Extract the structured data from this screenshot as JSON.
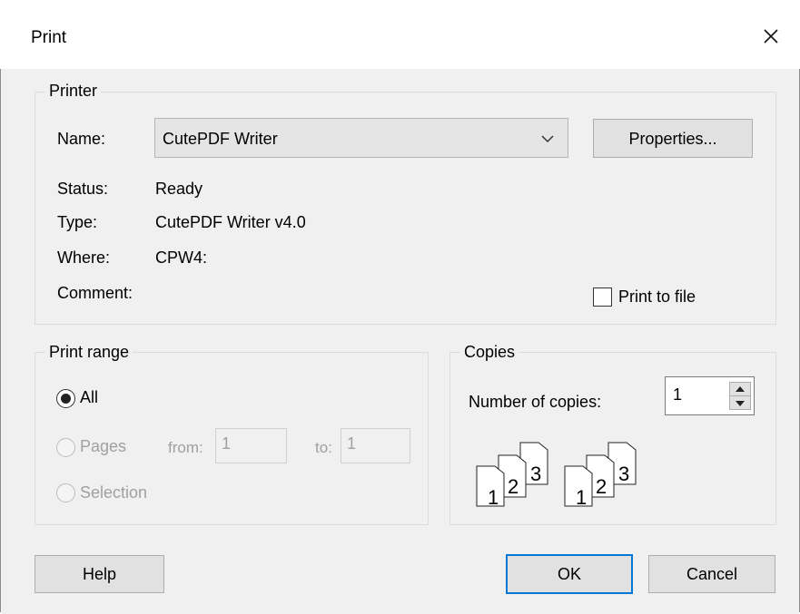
{
  "dialog": {
    "title": "Print"
  },
  "printer": {
    "group_label": "Printer",
    "name_label": "Name:",
    "name_value": "CutePDF Writer",
    "properties_label": "Properties...",
    "status_label": "Status:",
    "status_value": "Ready",
    "type_label": "Type:",
    "type_value": "CutePDF Writer v4.0",
    "where_label": "Where:",
    "where_value": "CPW4:",
    "comment_label": "Comment:",
    "print_to_file_label": "Print to file",
    "print_to_file_checked": false
  },
  "print_range": {
    "group_label": "Print range",
    "all_label": "All",
    "pages_label": "Pages",
    "from_label": "from:",
    "from_value": "1",
    "to_label": "to:",
    "to_value": "1",
    "selection_label": "Selection",
    "selected": "all"
  },
  "copies": {
    "group_label": "Copies",
    "number_label": "Number of copies:",
    "number_value": "1",
    "collate_icon_digits": [
      "1",
      "2",
      "3"
    ]
  },
  "buttons": {
    "help": "Help",
    "ok": "OK",
    "cancel": "Cancel"
  },
  "icons": [
    "close-icon",
    "chevron-down-icon",
    "spin-up-icon",
    "spin-down-icon",
    "collate-pages-icon"
  ]
}
